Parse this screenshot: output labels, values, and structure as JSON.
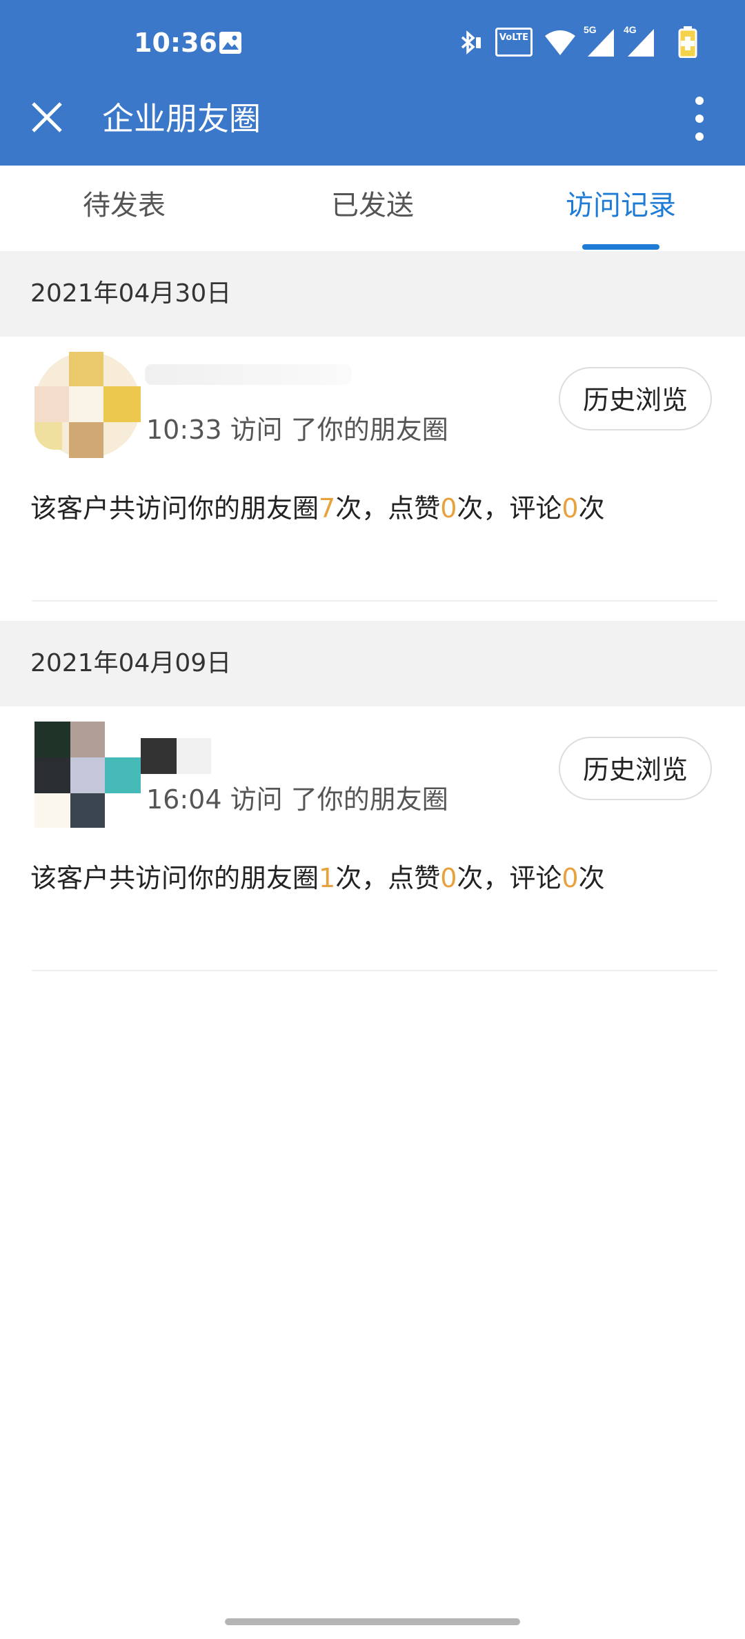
{
  "status_bar": {
    "time": "10:36",
    "icons": [
      "gallery-icon",
      "bluetooth-icon",
      "volte-icon",
      "wifi-icon",
      "signal-5g-icon",
      "signal-4g-icon",
      "battery-icon"
    ],
    "volte_text": "VoLTE",
    "net_5g": "5G",
    "net_4g": "4G"
  },
  "toolbar": {
    "title": "企业朋友圈",
    "close_icon": "close-icon",
    "more_icon": "more-vertical-icon"
  },
  "tabs": [
    {
      "label": "待发表",
      "active": false
    },
    {
      "label": "已发送",
      "active": false
    },
    {
      "label": "访问记录",
      "active": true
    }
  ],
  "colors": {
    "appbar": "#3c78c9",
    "accent": "#1e7bd6",
    "number_highlight": "#e6a23c"
  },
  "records": [
    {
      "date": "2021年04月30日",
      "visit_time": "10:33",
      "visit_text": "访问 了你的朋友圈",
      "button_label": "历史浏览",
      "summary": {
        "prefix": "该客户共访问你的朋友圈",
        "visits": "7",
        "visits_unit": "次，点赞",
        "likes": "0",
        "likes_unit": "次，评论",
        "comments": "0",
        "comments_unit": "次"
      }
    },
    {
      "date": "2021年04月09日",
      "visit_time": "16:04",
      "visit_text": "访问 了你的朋友圈",
      "button_label": "历史浏览",
      "summary": {
        "prefix": "该客户共访问你的朋友圈",
        "visits": "1",
        "visits_unit": "次，点赞",
        "likes": "0",
        "likes_unit": "次，评论",
        "comments": "0",
        "comments_unit": "次"
      }
    }
  ]
}
